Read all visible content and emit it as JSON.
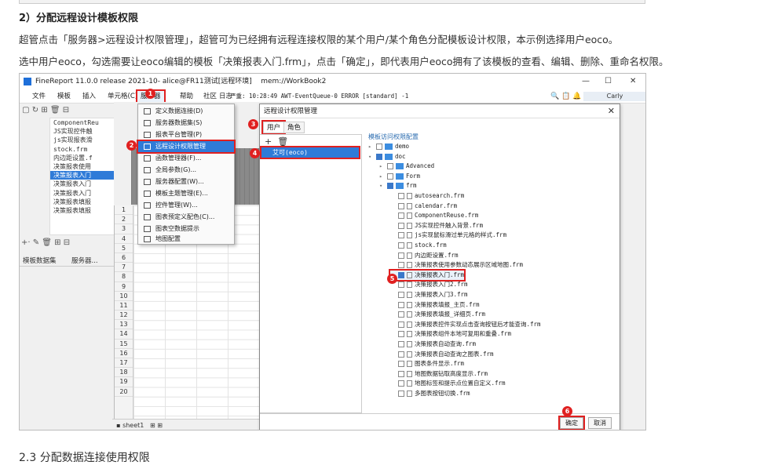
{
  "article": {
    "heading": "2）分配远程设计模板权限",
    "para1": "超管点击「服务器>远程设计权限管理」，超管可为已经拥有远程连接权限的某个用户/某个角色分配模板设计权限，本示例选择用户eoco。",
    "para2": "选中用户eoco，勾选需要让eoco编辑的模板「决策报表入门.frm」，点击「确定」，即代表用户eoco拥有了该模板的查看、编辑、删除、重命名权限。",
    "next_heading": "2.3 分配数据连接使用权限"
  },
  "app": {
    "title": "FineReport 11.0.0 release 2021-10-",
    "title_user": "alice@FR11测试[远程环境]",
    "title_doc": "mem://WorkBook2",
    "menu": [
      "文件",
      "模板",
      "插入",
      "单元格(C)",
      "服务器",
      "帮助",
      "社区",
      "日志"
    ],
    "status": "严重: 10:28:49 AWT-EventQueue-0 ERROR [standard] -1",
    "user_name": "Carly",
    "window_min": "—",
    "window_max": "☐",
    "window_close": "✕"
  },
  "left_tree": [
    "ComponentReu",
    "JS实现控件触",
    "js实现报表滑",
    "stock.frm",
    "内边距设置.f",
    "决策报表使用",
    "决策报表入门",
    "决策报表入门",
    "决策报表入门",
    "决策报表填报",
    "决策报表填报"
  ],
  "left_tabs": [
    "模板数据集",
    "服务器..."
  ],
  "row_numbers": [
    "1",
    "2",
    "3",
    "4",
    "5",
    "6",
    "7",
    "8",
    "9",
    "10",
    "11",
    "12",
    "13",
    "14",
    "15",
    "16",
    "17",
    "18",
    "19",
    "20"
  ],
  "sheet": "sheet1",
  "server_menu": [
    "定义数据连接(D)",
    "服务器数据集(S)",
    "报表平台管理(P)",
    "远程设计权限管理",
    "函数管理器(F)...",
    "全局参数(G)...",
    "服务器配置(W)...",
    "模板主题管理(E)...",
    "控件管理(W)...",
    "图表预定义配色(C)...",
    "图表空数据提示",
    "地图配置"
  ],
  "dialog": {
    "title": "远程设计权限管理",
    "close": "✕",
    "tabs": [
      "用户",
      "角色"
    ],
    "tool_add": "+",
    "tool_delete": "🗑",
    "user": "艾可(eoco)",
    "panel_title": "模板访问权限配置",
    "tree": [
      {
        "label": "demo",
        "kind": "folder",
        "level": 0,
        "arrow": "▸",
        "check": "off"
      },
      {
        "label": "doc",
        "kind": "folder",
        "level": 0,
        "arrow": "▾",
        "check": "part"
      },
      {
        "label": "Advanced",
        "kind": "folder",
        "level": 1,
        "arrow": "▸",
        "check": "off"
      },
      {
        "label": "Form",
        "kind": "folder",
        "level": 1,
        "arrow": "▸",
        "check": "off"
      },
      {
        "label": "frm",
        "kind": "folder",
        "level": 1,
        "arrow": "▾",
        "check": "part"
      },
      {
        "label": "autosearch.frm",
        "kind": "file",
        "level": 2,
        "check": "off"
      },
      {
        "label": "calendar.frm",
        "kind": "file",
        "level": 2,
        "check": "off"
      },
      {
        "label": "ComponentReuse.frm",
        "kind": "file",
        "level": 2,
        "check": "off"
      },
      {
        "label": "JS实现控件触入背景.frm",
        "kind": "file",
        "level": 2,
        "check": "off"
      },
      {
        "label": "js实现鼠标滑过单元格的样式.frm",
        "kind": "file",
        "level": 2,
        "check": "off"
      },
      {
        "label": "stock.frm",
        "kind": "file",
        "level": 2,
        "check": "off"
      },
      {
        "label": "内边距设置.frm",
        "kind": "file",
        "level": 2,
        "check": "off"
      },
      {
        "label": "决策报表使用参数动态展示区域地图.frm",
        "kind": "file",
        "level": 2,
        "check": "off"
      },
      {
        "label": "决策报表入门.frm",
        "kind": "file",
        "level": 2,
        "check": "on",
        "selected": true
      },
      {
        "label": "决策报表入门2.frm",
        "kind": "file",
        "level": 2,
        "check": "off"
      },
      {
        "label": "决策报表入门3.frm",
        "kind": "file",
        "level": 2,
        "check": "off"
      },
      {
        "label": "决策报表填报_主页.frm",
        "kind": "file",
        "level": 2,
        "check": "off"
      },
      {
        "label": "决策报表填报_详细页.frm",
        "kind": "file",
        "level": 2,
        "check": "off"
      },
      {
        "label": "决策报表控件实现点击查询按钮后才能查询.frm",
        "kind": "file",
        "level": 2,
        "check": "off"
      },
      {
        "label": "决策报表组件本地可复用和重叠.frm",
        "kind": "file",
        "level": 2,
        "check": "off"
      },
      {
        "label": "决策报表自动查询.frm",
        "kind": "file",
        "level": 2,
        "check": "off"
      },
      {
        "label": "决策报表自动查询之图表.frm",
        "kind": "file",
        "level": 2,
        "check": "off"
      },
      {
        "label": "图表条件显示.frm",
        "kind": "file",
        "level": 2,
        "check": "off"
      },
      {
        "label": "地图数据钻取高度显示.frm",
        "kind": "file",
        "level": 2,
        "check": "off"
      },
      {
        "label": "地图标签和提示点位置自定义.frm",
        "kind": "file",
        "level": 2,
        "check": "off"
      },
      {
        "label": "多图表按钮切换.frm",
        "kind": "file",
        "level": 2,
        "check": "off"
      }
    ],
    "ok": "确定",
    "cancel": "取消"
  },
  "badges": [
    "1",
    "2",
    "3",
    "4",
    "5",
    "6"
  ]
}
